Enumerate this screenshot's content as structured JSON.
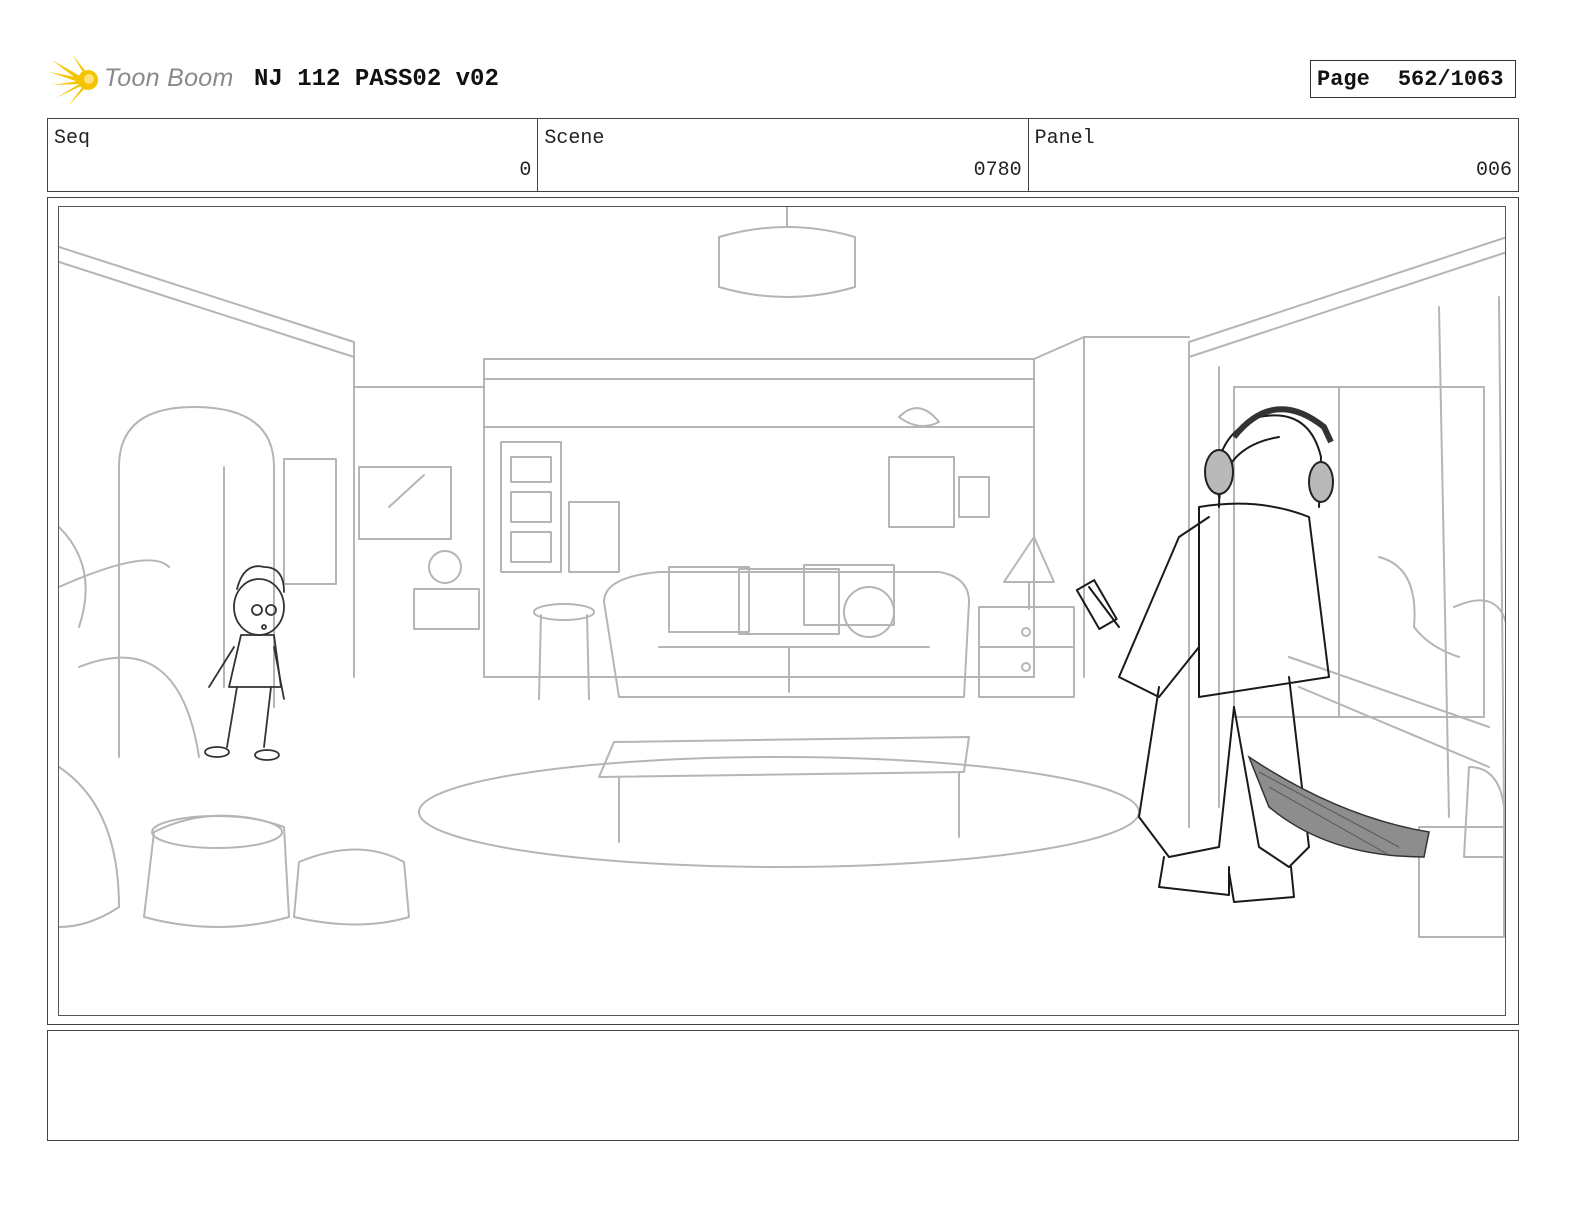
{
  "header": {
    "logo_text": "Toon Boom",
    "title": "NJ 112 PASS02 v02",
    "page_label": "Page",
    "page_value": "562/1063"
  },
  "info": {
    "seq_label": "Seq",
    "seq_value": "0",
    "scene_label": "Scene",
    "scene_value": "0780",
    "panel_label": "Panel",
    "panel_value": "006"
  },
  "notes": {
    "text": ""
  },
  "colors": {
    "sketch_line": "#b5b5b5",
    "character_line": "#222222",
    "logo_sun": "#f5c400",
    "logo_text": "#8a8a8a"
  }
}
